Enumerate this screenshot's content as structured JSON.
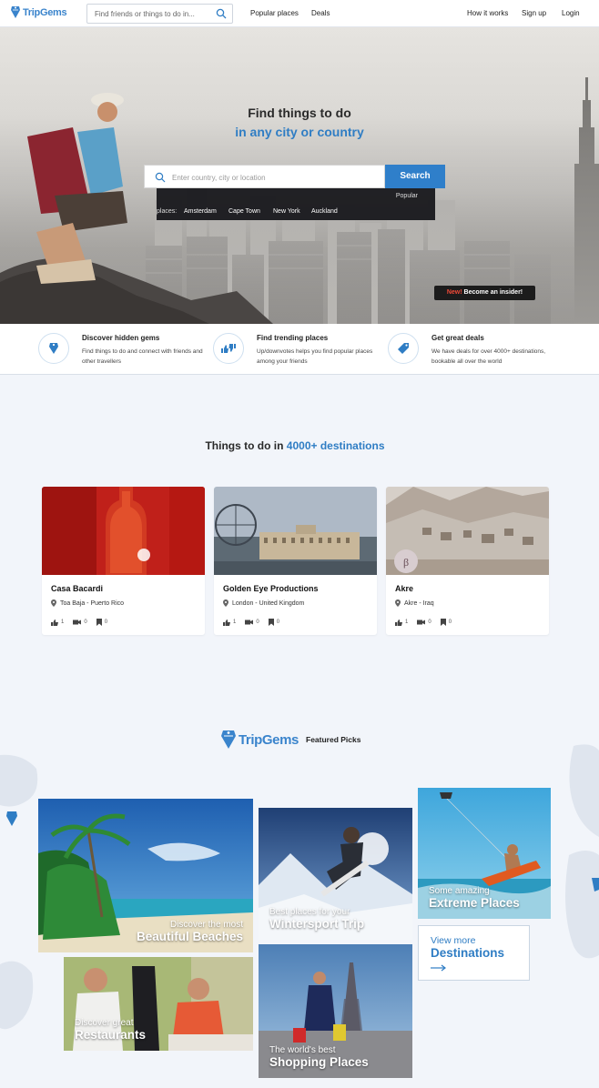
{
  "nav": {
    "logo": "TripGems",
    "search_placeholder": "Find friends or things to do in...",
    "links": {
      "popular": "Popular places",
      "deals": "Deals",
      "how": "How it works",
      "signup": "Sign up",
      "login": "Login"
    }
  },
  "hero": {
    "title_line1": "Find things to do",
    "title_line2": "in any city or country",
    "search_placeholder": "Enter country, city or location",
    "search_button": "Search",
    "popular_label": "Popular",
    "places_prefix": "places:",
    "places": [
      "Amsterdam",
      "Cape Town",
      "New York",
      "Auckland"
    ],
    "insider_new": "New!",
    "insider_text": "Become an insider!"
  },
  "features": [
    {
      "title": "Discover hidden gems",
      "desc": "Find things to do and connect with friends and other travellers",
      "icon": "gem-icon"
    },
    {
      "title": "Find trending places",
      "desc": "Up/downvotes helps you find popular places among your friends",
      "icon": "thumbs-icon"
    },
    {
      "title": "Get great deals",
      "desc": "We have deals for over 4000+ destinations, bookable all over the world",
      "icon": "tag-icon"
    }
  ],
  "things": {
    "title_prefix": "Things to do in",
    "title_highlight": "4000+ destinations",
    "cards": [
      {
        "name": "Casa Bacardi",
        "location": "Toa Baja - Puerto Rico",
        "likes": "1",
        "videos": "0",
        "bookmarks": "0"
      },
      {
        "name": "Golden Eye Productions",
        "location": "London - United Kingdom",
        "likes": "1",
        "videos": "0",
        "bookmarks": "0"
      },
      {
        "name": "Akre",
        "location": "Akre - Iraq",
        "likes": "1",
        "videos": "0",
        "bookmarks": "0"
      }
    ]
  },
  "featured": {
    "logo": "TripGems",
    "subtitle": "Featured Picks",
    "tiles": {
      "beaches": {
        "l1": "Discover the most",
        "l2": "Beautiful Beaches"
      },
      "winter": {
        "l1": "Best places for your",
        "l2": "Wintersport Trip"
      },
      "extreme": {
        "l1": "Some amazing",
        "l2": "Extreme Places"
      },
      "restaurants": {
        "l1": "Discover great",
        "l2": "Restaurants"
      },
      "shopping": {
        "l1": "The world's best",
        "l2": "Shopping Places"
      }
    },
    "view_more": {
      "l1": "View more",
      "l2": "Destinations"
    }
  },
  "colors": {
    "accent": "#2f7dc4",
    "brand": "#3a84cc",
    "new_badge": "#f04a38"
  }
}
